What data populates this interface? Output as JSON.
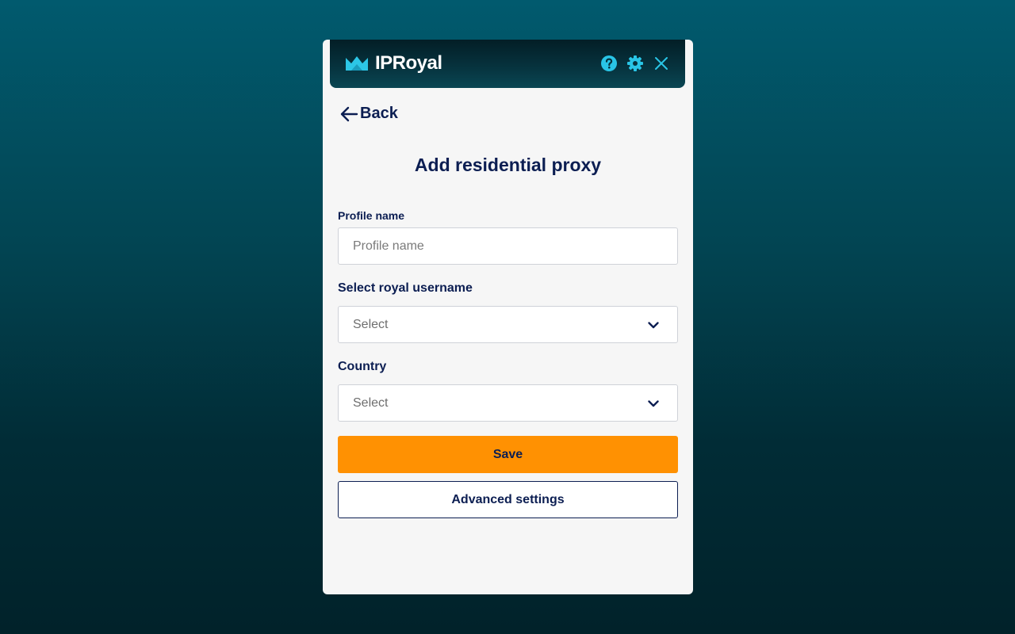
{
  "header": {
    "brand": "IPRoyal",
    "icons": [
      "crown-logo-icon",
      "help-icon",
      "gear-icon",
      "close-icon"
    ],
    "accent_color": "#29c5e6"
  },
  "nav": {
    "back_label": "Back"
  },
  "form": {
    "title": "Add residential proxy",
    "profile_name": {
      "label": "Profile name",
      "placeholder": "Profile name",
      "value": ""
    },
    "royal_username": {
      "label": "Select royal username",
      "value": "Select"
    },
    "country": {
      "label": "Country",
      "value": "Select"
    },
    "save_label": "Save",
    "advanced_label": "Advanced settings"
  },
  "colors": {
    "primary_text": "#0c1e52",
    "save_button": "#ff9102",
    "panel_background": "#f6f6f6"
  }
}
